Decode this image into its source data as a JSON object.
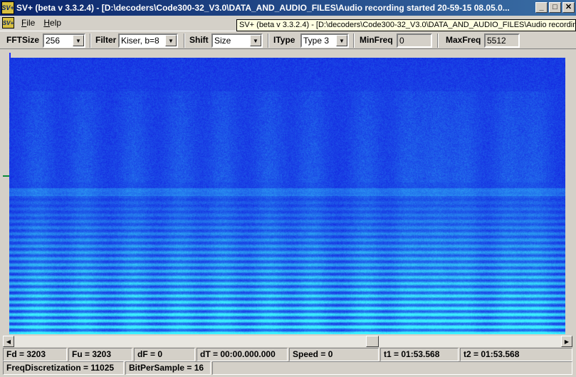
{
  "window": {
    "title": "SV+ (beta v 3.3.2.4) - [D:\\decoders\\Code300-32_V3.0\\DATA_AND_AUDIO_FILES\\Audio recording started 20-59-15  08.05.0...",
    "icon_text": "SV+",
    "minimize": "_",
    "maximize": "□",
    "close": "✕"
  },
  "menu": {
    "icon_text": "SV+",
    "items": [
      "File",
      "Help"
    ]
  },
  "tooltip": "SV+ (beta v 3.3.2.4) - [D:\\decoders\\Code300-32_V3.0\\DATA_AND_AUDIO_FILES\\Audio recording",
  "toolbar": {
    "fftsize_label": "FFTSize",
    "fftsize_value": "256",
    "filter_label": "Filter",
    "filter_value": "Kiser, b=8",
    "shift_label": "Shift",
    "shift_value": "Size",
    "itype_label": "IType",
    "itype_value": "Type 3",
    "minfreq_label": "MinFreq",
    "minfreq_value": "0",
    "maxfreq_label": "MaxFreq",
    "maxfreq_value": "5512"
  },
  "colors": {
    "spectrogram_base": "#1530e8",
    "spectrogram_high": "#2fe0f0"
  },
  "status": {
    "fd": "Fd = 3203",
    "fu": "Fu = 3203",
    "df": "dF = 0",
    "dt": "dT = 00:00.000.000",
    "speed": "Speed = 0",
    "t1": "t1 = 01:53.568",
    "t2": "t2 = 01:53.568",
    "freq_disc": "FreqDiscretization = 11025",
    "bps": "BitPerSample = 16"
  }
}
